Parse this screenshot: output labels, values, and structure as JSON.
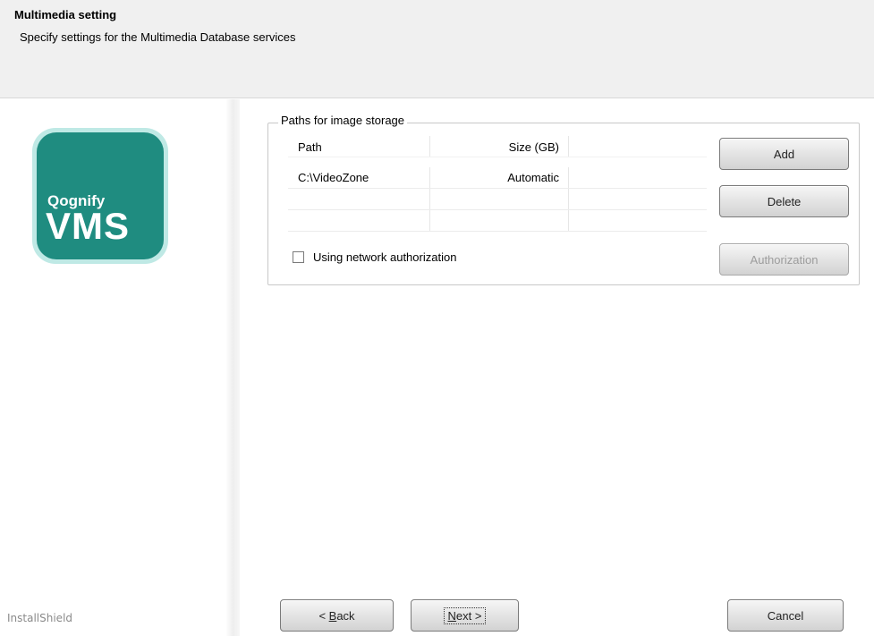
{
  "header": {
    "title": "Multimedia setting",
    "subtitle": "Specify settings for the Multimedia Database services"
  },
  "logo": {
    "small_text": "Qognify",
    "big_text": "VMS",
    "colors": {
      "tile": "#1f8c80",
      "ring": "#bfe9e5"
    }
  },
  "storage": {
    "group_label": "Paths for image storage",
    "columns": [
      "Path",
      "Size (GB)"
    ],
    "rows": [
      {
        "path": "C:\\VideoZone",
        "size": "Automatic"
      }
    ],
    "buttons": {
      "add": "Add",
      "delete": "Delete",
      "authorization": "Authorization"
    },
    "network_auth": {
      "label": "Using network authorization",
      "checked": false
    }
  },
  "footer": {
    "brand": "InstallShield",
    "back_prefix": "< ",
    "back_key": "B",
    "back_rest": "ack",
    "next_key": "N",
    "next_rest": "ext >",
    "cancel": "Cancel"
  }
}
